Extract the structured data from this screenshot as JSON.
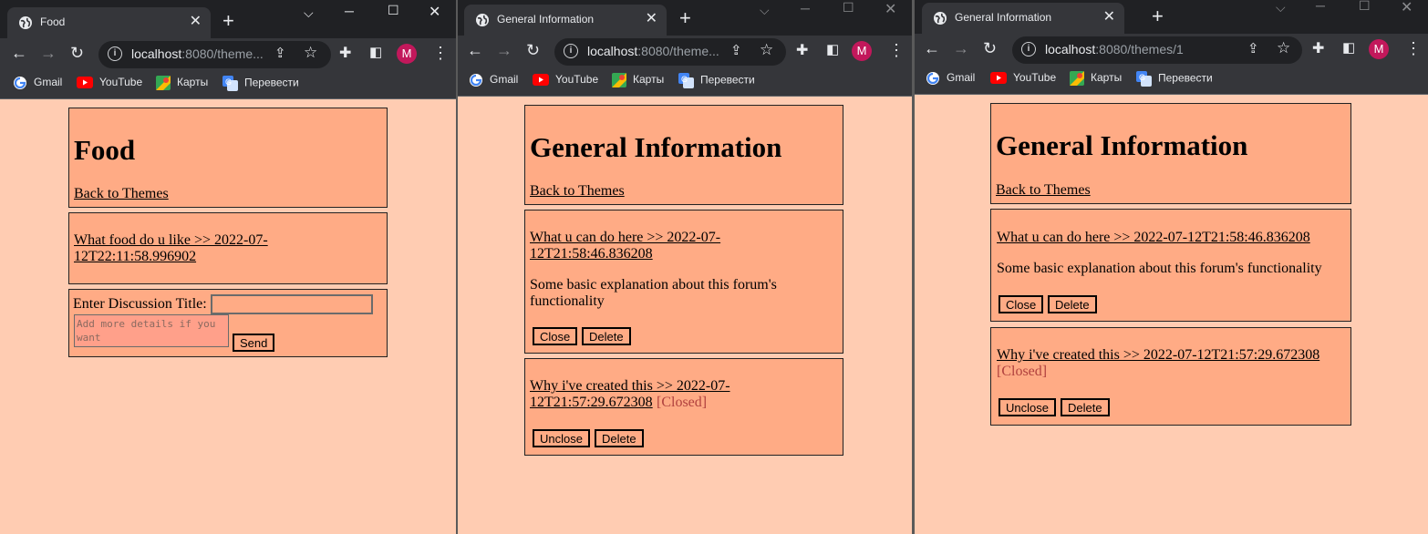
{
  "windows": [
    {
      "tab_title": "Food",
      "url_host": "localhost",
      "url_rest": ":8080/theme...",
      "avatar_letter": "M",
      "bookmarks": [
        "Gmail",
        "YouTube",
        "Карты",
        "Перевести"
      ],
      "page": {
        "title": "Food",
        "back_link": "Back to Themes",
        "topic_link_line1": "What food do u like >> 2022-07-",
        "topic_link_line2": "12T22:11:58.996902",
        "form_label": "Enter Discussion Title:",
        "title_input_value": "",
        "details_placeholder": "Add more details if you want",
        "send_label": "Send"
      }
    },
    {
      "tab_title": "General Information",
      "url_host": "localhost",
      "url_rest": ":8080/theme...",
      "avatar_letter": "M",
      "bookmarks": [
        "Gmail",
        "YouTube",
        "Карты",
        "Перевести"
      ],
      "page": {
        "title": "General Information",
        "back_link": "Back to Themes",
        "topic1_line1": "What u can do here >> 2022-07-",
        "topic1_line2": "12T21:58:46.836208",
        "topic1_desc_line1": "Some basic explanation about this forum's",
        "topic1_desc_line2": "functionality",
        "close_label": "Close",
        "delete_label": "Delete",
        "topic2_line1": "Why i've created this >> 2022-07-",
        "topic2_line2": "12T21:57:29.672308",
        "closed_tag": "[Closed]",
        "unclose_label": "Unclose",
        "delete2_label": "Delete"
      }
    },
    {
      "tab_title": "General Information",
      "url_host": "localhost",
      "url_rest": ":8080/themes/1",
      "avatar_letter": "M",
      "bookmarks": [
        "Gmail",
        "YouTube",
        "Карты",
        "Перевести"
      ],
      "page": {
        "title": "General Information",
        "back_link": "Back to Themes",
        "topic1": "What u can do here >> 2022-07-12T21:58:46.836208",
        "topic1_desc": "Some basic explanation about this forum's functionality",
        "close_label": "Close",
        "delete_label": "Delete",
        "topic2": "Why i've created this >> 2022-07-12T21:57:29.672308",
        "closed_tag": "[Closed]",
        "unclose_label": "Unclose",
        "delete2_label": "Delete"
      }
    }
  ],
  "colors": {
    "page_bg": "#ffccb2",
    "box_bg": "#ffab85",
    "closed_text": "#b0413e",
    "chrome_dark": "#202124",
    "chrome_toolbar": "#35363a",
    "avatar": "#c2185b"
  },
  "icons": {
    "tab_favicon": "globe-icon",
    "back": "arrow-left-icon",
    "forward": "arrow-right-icon",
    "reload": "reload-icon",
    "info": "info-icon",
    "share": "share-icon",
    "bookmark_star": "star-icon",
    "extensions": "puzzle-icon",
    "sidepanel": "sidepanel-icon",
    "menu": "kebab-menu-icon"
  }
}
